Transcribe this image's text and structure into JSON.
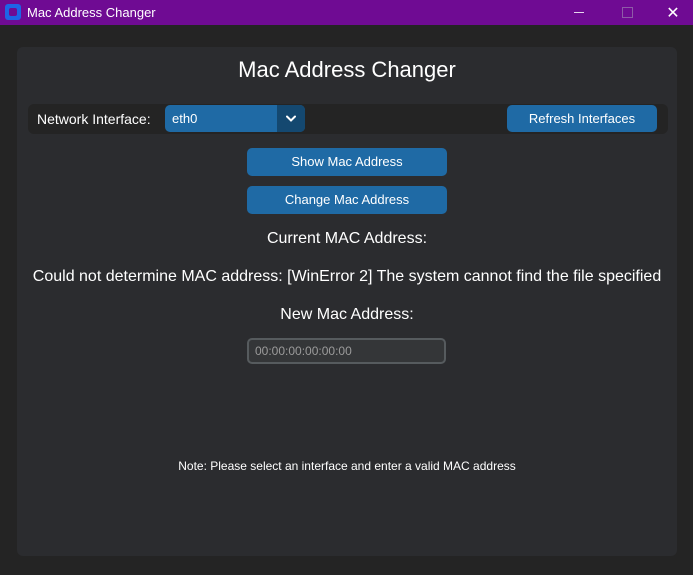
{
  "window": {
    "title": "Mac Address Changer",
    "minimize_glyph": "—",
    "maximize_glyph": "□",
    "close_glyph": "✕",
    "titlebar_color": "#6f0b93"
  },
  "main": {
    "heading": "Mac Address Changer",
    "interface": {
      "label": "Network Interface:",
      "selected": "eth0",
      "refresh_label": "Refresh Interfaces"
    },
    "show_button": "Show Mac Address",
    "change_button": "Change Mac Address",
    "current_label": "Current MAC Address:",
    "current_value": "Could not determine MAC address: [WinError 2] The system cannot find the file specified",
    "new_label": "New Mac Address:",
    "new_input": {
      "value": "",
      "placeholder": "00:00:00:00:00:00"
    },
    "note": "Note: Please select an interface and enter a valid MAC address"
  },
  "colors": {
    "accent": "#1f6aa5",
    "accent_dark": "#144870",
    "background": "#242424",
    "panel": "#2b2c2f"
  },
  "icons": {
    "app": "app-icon",
    "dropdown": "chevron-down-icon"
  }
}
